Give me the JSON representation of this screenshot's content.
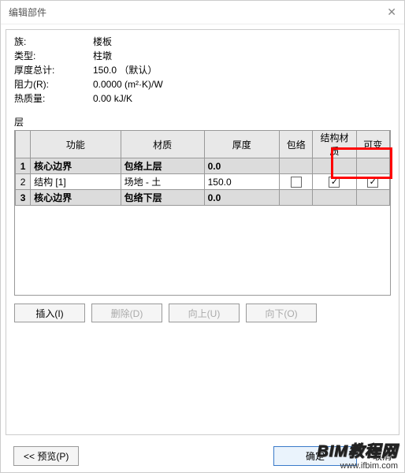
{
  "title": "编辑部件",
  "properties": {
    "family_label": "族:",
    "family_value": "楼板",
    "type_label": "类型:",
    "type_value": "柱墩",
    "thickness_label": "厚度总计:",
    "thickness_value": "150.0 （默认）",
    "resistance_label": "阻力(R):",
    "resistance_value": "0.0000 (m²·K)/W",
    "thermalmass_label": "热质量:",
    "thermalmass_value": "0.00 kJ/K"
  },
  "layers_label": "层",
  "columns": {
    "function": "功能",
    "material": "材质",
    "thickness": "厚度",
    "wraps": "包络",
    "structmat": "结构材质",
    "variable": "可变"
  },
  "rows": [
    {
      "n": "1",
      "func": "核心边界",
      "mat": "包络上层",
      "thk": "0.0",
      "gray": true
    },
    {
      "n": "2",
      "func": "结构 [1]",
      "mat": "场地 - 土",
      "thk": "150.0",
      "gray": false,
      "struct_checked": true,
      "var_checked": true
    },
    {
      "n": "3",
      "func": "核心边界",
      "mat": "包络下层",
      "thk": "0.0",
      "gray": true
    }
  ],
  "buttons": {
    "insert": "插入(I)",
    "delete": "删除(D)",
    "up": "向上(U)",
    "down": "向下(O)",
    "preview": "<< 预览(P)",
    "ok": "确定",
    "cancel": "取消"
  },
  "watermark": {
    "line1": "BIM教程网",
    "line2": "www.ifbim.com"
  }
}
